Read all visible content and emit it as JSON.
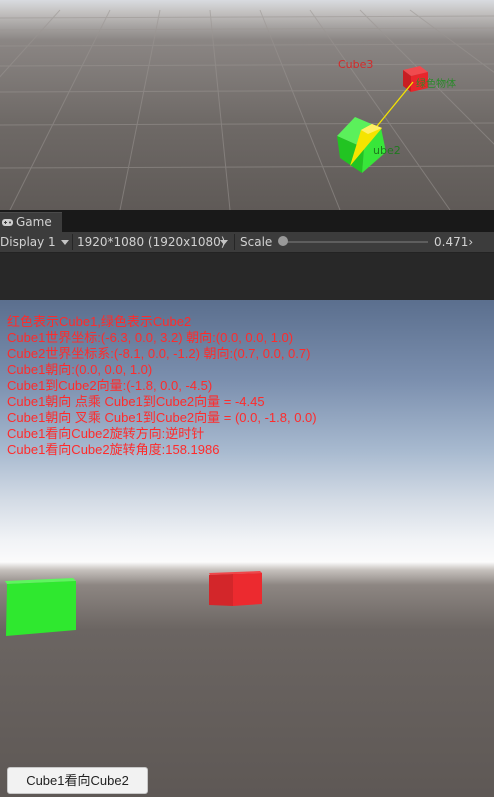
{
  "scene": {
    "labels": {
      "cube3": "Cube3",
      "cube2": "ube2",
      "green_label": "绿色物体"
    },
    "colors": {
      "red_cube": "#e8262b",
      "green_cube": "#38e63a",
      "gizmo": "#f5e400"
    }
  },
  "tab": {
    "label": "Game",
    "icon": "gamepad-icon"
  },
  "toolbar": {
    "display": "Display 1",
    "resolution": "1920*1080 (1920x1080)",
    "scale_label": "Scale",
    "scale_value": "0.471›"
  },
  "game": {
    "info_lines": [
      "红色表示Cube1,绿色表示Cube2",
      "Cube1世界坐标:(-6.3, 0.0, 3.2) 朝向:(0.0, 0.0, 1.0)",
      "Cube2世界坐标系:(-8.1, 0.0, -1.2) 朝向:(0.7, 0.0, 0.7)",
      "Cube1朝向:(0.0, 0.0, 1.0)",
      "Cube1到Cube2向量:(-1.8, 0.0, -4.5)",
      "Cube1朝向 点乘 Cube1到Cube2向量 = -4.45",
      "Cube1朝向 叉乘 Cube1到Cube2向量 = (0.0, -1.8, 0.0)",
      "Cube1看向Cube2旋转方向:逆时针",
      "Cube1看向Cube2旋转角度:158.1986"
    ],
    "button_label": "Cube1看向Cube2",
    "colors": {
      "info_text": "#ff2b2b",
      "red_cube": "#e8262b",
      "green_cube": "#2fe82f"
    }
  }
}
